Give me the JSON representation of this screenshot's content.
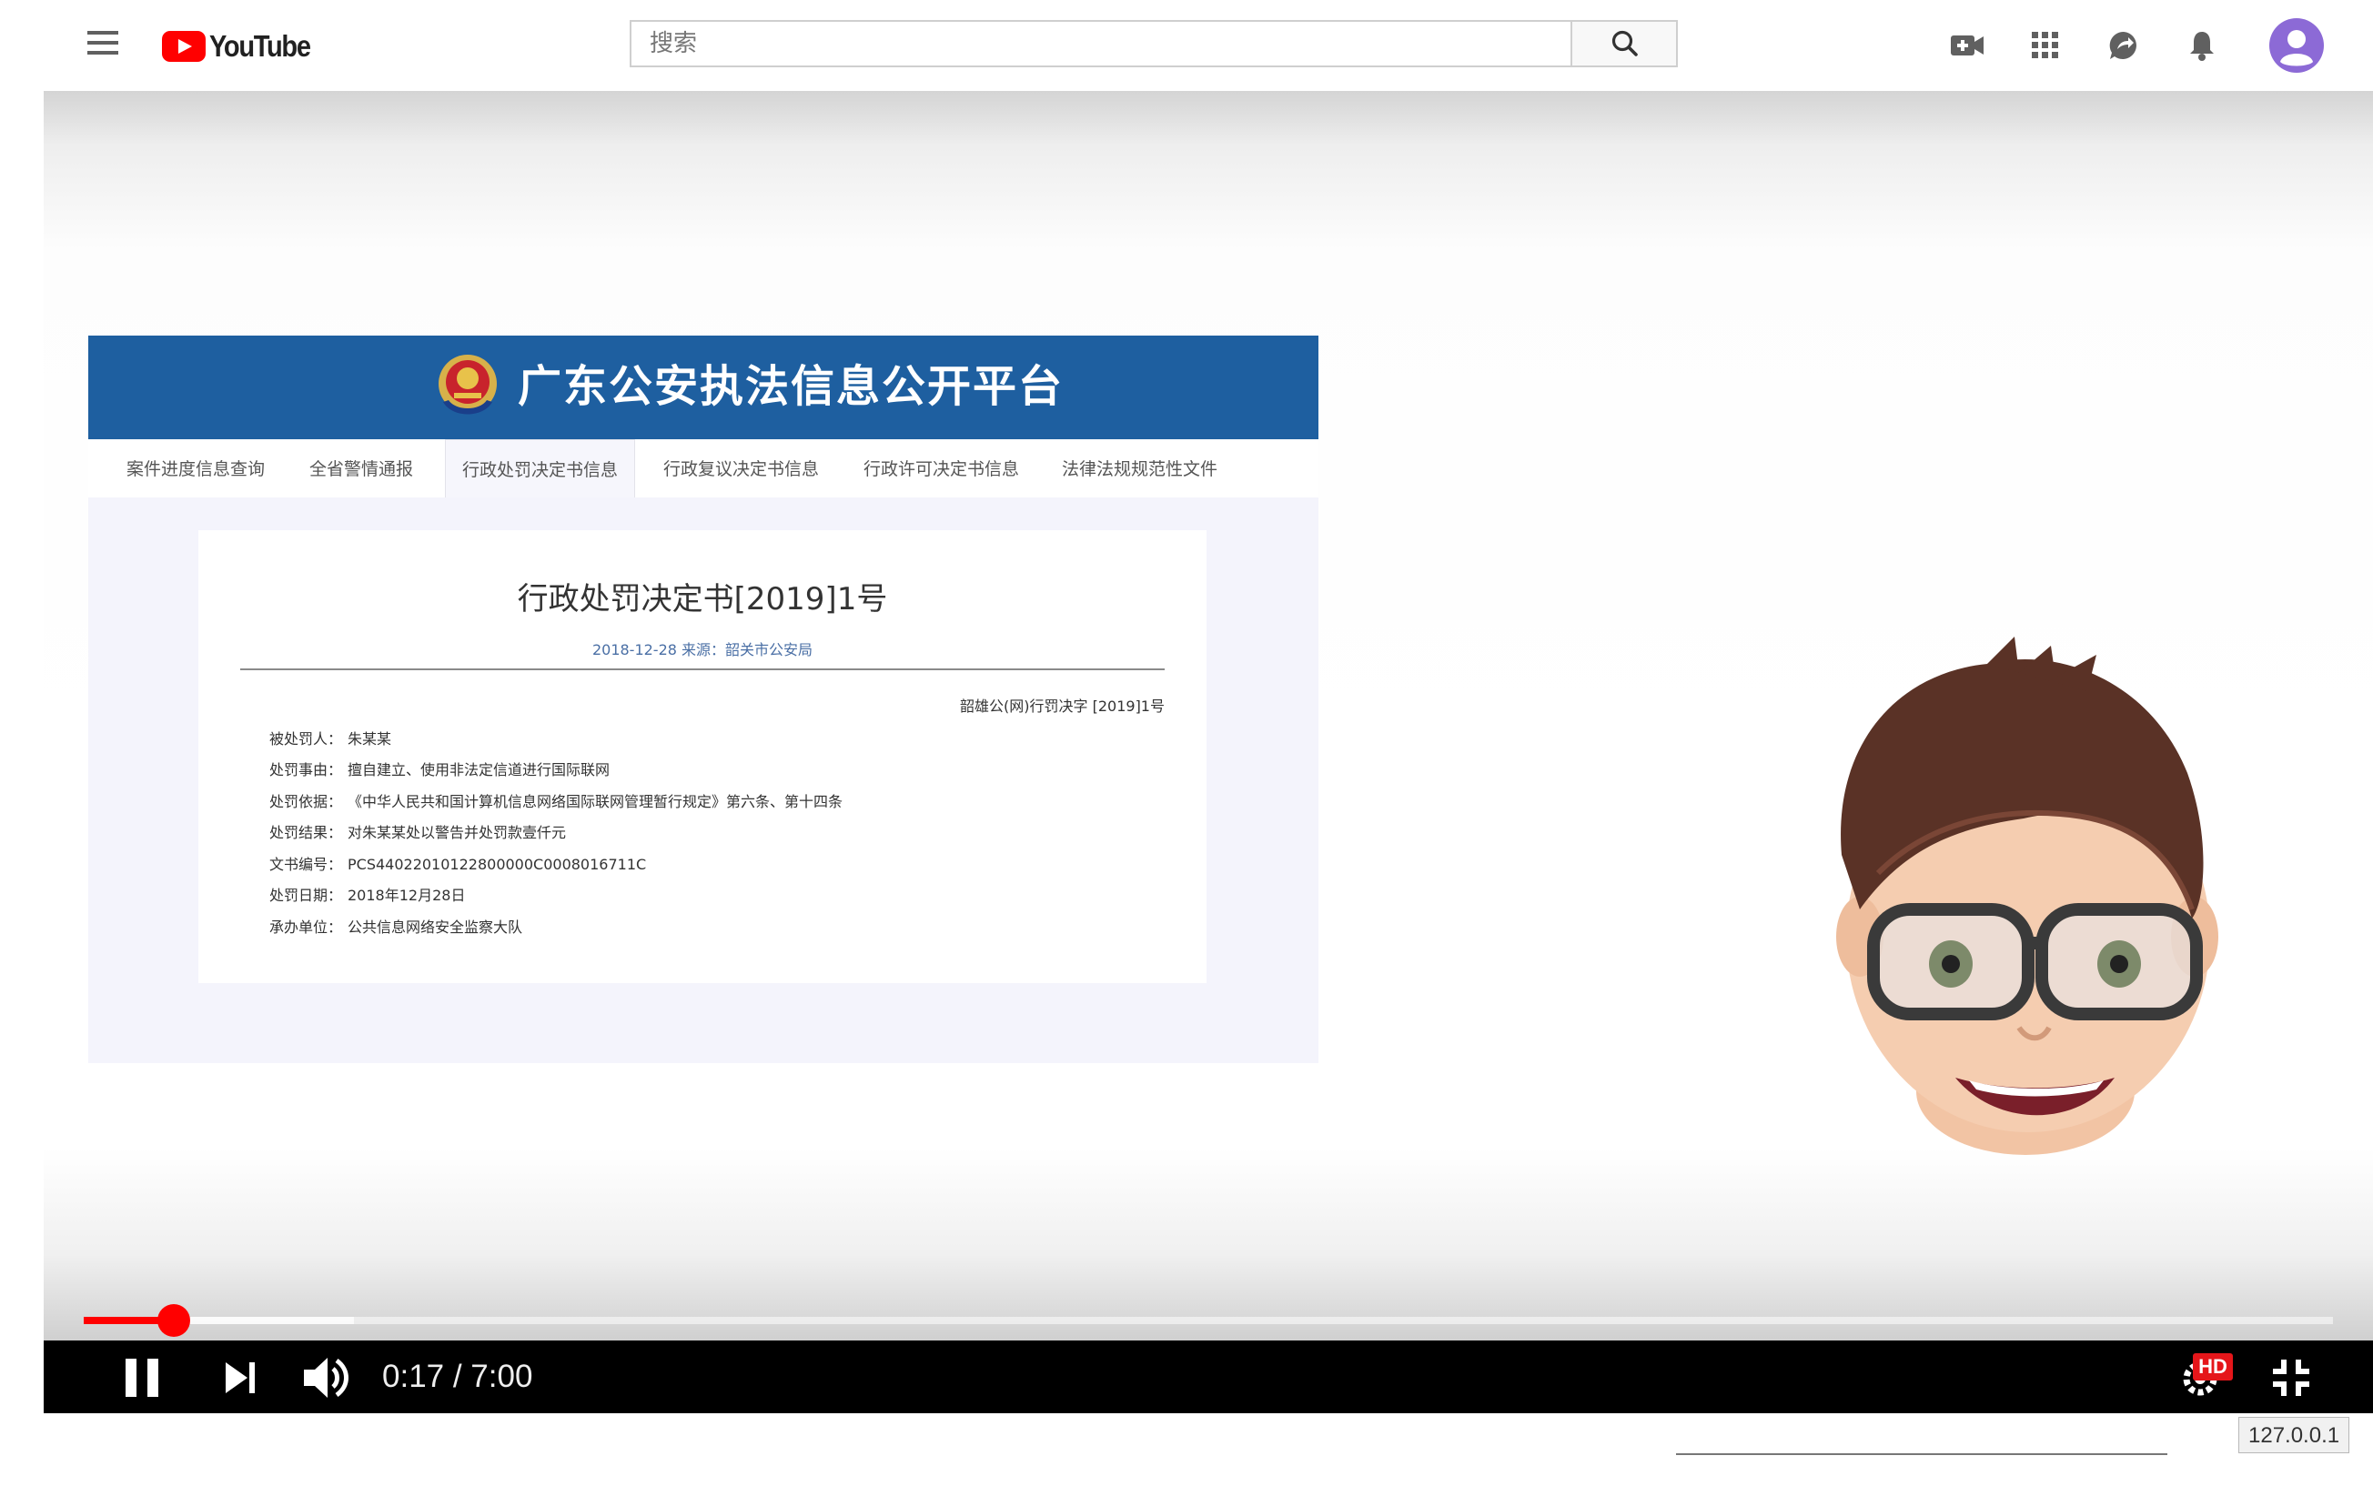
{
  "masthead": {
    "logo_text": "YouTube",
    "search_placeholder": "搜索",
    "icons": [
      "menu-icon",
      "youtube-logo",
      "search-icon",
      "create-video-icon",
      "apps-grid-icon",
      "messages-icon",
      "notifications-bell-icon",
      "account-avatar"
    ]
  },
  "video": {
    "slide": {
      "site_title": "广东公安执法信息公开平台",
      "tabs": [
        "案件进度信息查询",
        "全省警情通报",
        "行政处罚决定书信息",
        "行政复议决定书信息",
        "行政许可决定书信息",
        "法律法规规范性文件"
      ],
      "active_tab_index": 2,
      "doc_title": "行政处罚决定书[2019]1号",
      "doc_meta": "2018-12-28    来源：韶关市公安局",
      "doc_ref": "韶雄公(网)行罚决字 [2019]1号",
      "fields": [
        {
          "label": "被处罚人：",
          "value": "朱某某"
        },
        {
          "label": "处罚事由：",
          "value": "擅自建立、使用非法定信道进行国际联网"
        },
        {
          "label": "处罚依据：",
          "value": "《中华人民共和国计算机信息网络国际联网管理暂行规定》第六条、第十四条"
        },
        {
          "label": "处罚结果：",
          "value": "对朱某某处以警告并处罚款壹仟元"
        },
        {
          "label": "文书编号：",
          "value": "PCS44022010122800000C0008016711C"
        },
        {
          "label": "处罚日期：",
          "value": "2018年12月28日"
        },
        {
          "label": "承办单位：",
          "value": "公共信息网络安全监察大队"
        }
      ]
    },
    "player": {
      "progress_fraction": 0.04,
      "buffered_fraction": 0.12,
      "current_time": "0:17",
      "duration": "7:00",
      "time_display": "0:17 / 7:00",
      "quality_badge": "HD",
      "accent_color": "#ff0000"
    }
  },
  "browser": {
    "status_host": "127.0.0.1"
  }
}
